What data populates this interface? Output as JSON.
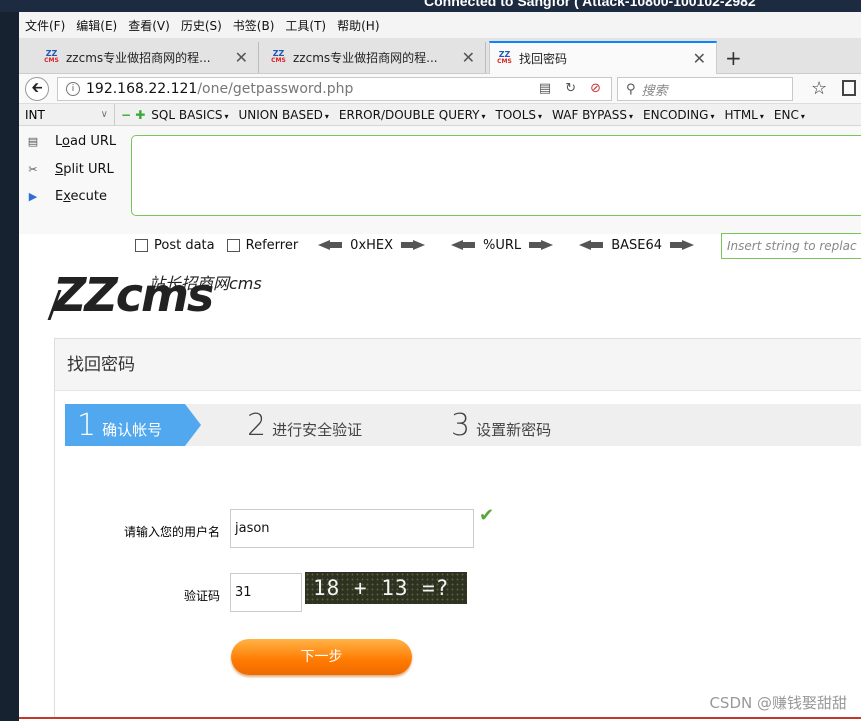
{
  "remote_banner": "Connected to Sangfor ( Attack-10800-100102-2982",
  "menu": [
    "文件(F)",
    "编辑(E)",
    "查看(V)",
    "历史(S)",
    "书签(B)",
    "工具(T)",
    "帮助(H)"
  ],
  "tabs": [
    {
      "title": "zzcms专业做招商网的程...",
      "close": "✕"
    },
    {
      "title": "zzcms专业做招商网的程...",
      "close": "✕"
    },
    {
      "title": "找回密码",
      "close": "✕"
    }
  ],
  "new_tab": "+",
  "url": {
    "host": "192.168.22.121",
    "path": "/one/getpassword.php"
  },
  "search_placeholder": "搜索",
  "hackbar": {
    "select_value": "INT",
    "menus": [
      "SQL BASICS",
      "UNION BASED",
      "ERROR/DOUBLE QUERY",
      "TOOLS",
      "WAF BYPASS",
      "ENCODING",
      "HTML",
      "ENC"
    ],
    "actions": [
      "Load URL",
      "Split URL",
      "Execute"
    ],
    "post_data": "Post data",
    "referrer": "Referrer",
    "enc": [
      "0xHEX",
      "%URL",
      "BASE64"
    ],
    "insert_placeholder": "Insert string to replac"
  },
  "site": {
    "logo_main": "ZZcms",
    "logo_sub": "站长招商网cms",
    "panel_title": "找回密码",
    "steps": [
      {
        "num": "1",
        "label": "确认帐号"
      },
      {
        "num": "2",
        "label": "进行安全验证"
      },
      {
        "num": "3",
        "label": "设置新密码"
      }
    ],
    "username_label": "请输入您的用户名",
    "username_value": "jason",
    "captcha_label": "验证码",
    "captcha_value": "31",
    "captcha_image_text": "18 + 13 =?",
    "next_button": "下一步"
  },
  "watermark": "CSDN @赚钱娶甜甜"
}
